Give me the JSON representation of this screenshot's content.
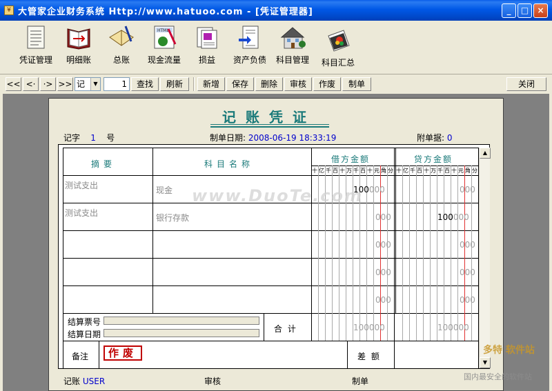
{
  "window": {
    "title": "大管家企业财务系统 Http://www.hatuoo.com - [凭证管理器]",
    "minimize": "_",
    "maximize": "□",
    "close": "×"
  },
  "toolbar": [
    {
      "label": "凭证管理",
      "icon": "voucher-icon"
    },
    {
      "label": "明细账",
      "icon": "ledger-book-icon"
    },
    {
      "label": "总账",
      "icon": "general-ledger-icon"
    },
    {
      "label": "现金流量",
      "icon": "cash-flow-icon"
    },
    {
      "label": "损益",
      "icon": "profit-loss-icon"
    },
    {
      "label": "资产负债",
      "icon": "balance-sheet-icon"
    },
    {
      "label": "科目管理",
      "icon": "account-house-icon"
    },
    {
      "label": "科目汇总",
      "icon": "summary-cards-icon"
    }
  ],
  "navbar": {
    "first": "<<",
    "prev": "<·",
    "next": "·>",
    "last": ">>",
    "type_value": "记",
    "number_value": "1",
    "find": "查找",
    "refresh": "刷新",
    "add": "新增",
    "save": "保存",
    "delete": "删除",
    "audit": "审核",
    "void": "作废",
    "create": "制单",
    "close": "关闭"
  },
  "voucher": {
    "title": "记账凭证",
    "word_label": "记字",
    "number": "1",
    "number_unit": "号",
    "date_label": "制单日期:",
    "date": "2008-06-19 18:33:19",
    "attach_label": "附单据:",
    "attach_count": "0",
    "headers": {
      "summary": "摘要",
      "account": "科目名称",
      "debit": "借方金额",
      "credit": "贷方金额"
    },
    "units": [
      "十",
      "亿",
      "千",
      "百",
      "十",
      "万",
      "千",
      "百",
      "十",
      "元",
      "角",
      "分"
    ],
    "rows": [
      {
        "summary": "测试支出",
        "account": "现金",
        "debit_digits": "100",
        "debit_zeros": "000",
        "credit_digits": "",
        "credit_zeros": "000"
      },
      {
        "summary": "测试支出",
        "account": "银行存款",
        "debit_digits": "",
        "debit_zeros": "000",
        "credit_digits": "100",
        "credit_zeros": "000"
      },
      {
        "summary": "",
        "account": "",
        "debit_digits": "",
        "debit_zeros": "000",
        "credit_digits": "",
        "credit_zeros": "000"
      },
      {
        "summary": "",
        "account": "",
        "debit_digits": "",
        "debit_zeros": "000",
        "credit_digits": "",
        "credit_zeros": "000"
      },
      {
        "summary": "",
        "account": "",
        "debit_digits": "",
        "debit_zeros": "000",
        "credit_digits": "",
        "credit_zeros": "000"
      }
    ],
    "settle_no_label": "结算票号",
    "settle_date_label": "结算日期",
    "total_label": "合 计",
    "total_debit": "100000",
    "total_credit": "100000",
    "remark_label": "备注",
    "stamp": "作废",
    "diff_label": "差 额",
    "bookkeeper_label": "记账",
    "bookkeeper": "USER",
    "auditor_label": "审核",
    "maker_label": "制单"
  },
  "watermarks": {
    "main": "www.DuoTe.com",
    "corner": "多特 软件站",
    "corner2": "国内最安全的软件站"
  },
  "colors": {
    "titlebar": "#0058e6",
    "teal": "#1a7a7a",
    "blue_text": "#0000cc",
    "stamp_red": "#c00000",
    "workspace": "#808080"
  }
}
